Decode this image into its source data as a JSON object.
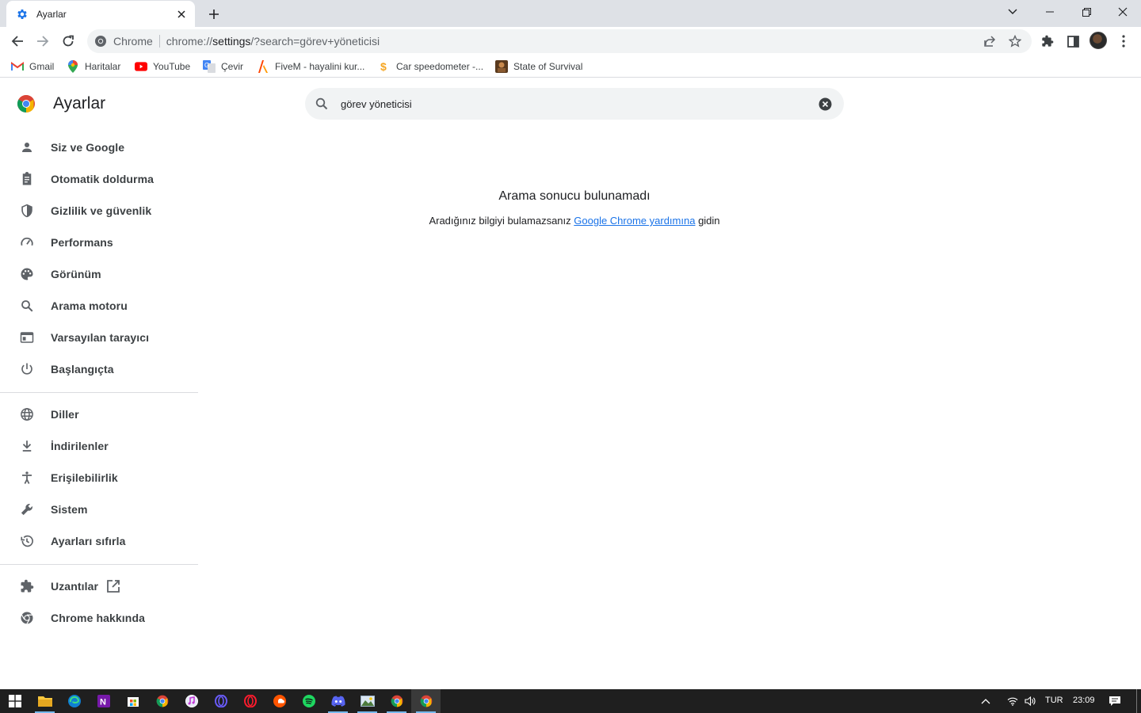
{
  "tab": {
    "title": "Ayarlar"
  },
  "omnibox": {
    "chip": "Chrome",
    "url_host": "chrome://",
    "url_path": "settings",
    "url_query": "/?search=görev+yöneticisi"
  },
  "bookmarks": [
    {
      "label": "Gmail",
      "icon": "gmail-icon"
    },
    {
      "label": "Haritalar",
      "icon": "maps-icon"
    },
    {
      "label": "YouTube",
      "icon": "youtube-icon"
    },
    {
      "label": "Çevir",
      "icon": "translate-icon"
    },
    {
      "label": "FiveM - hayalini kur...",
      "icon": "fivem-icon"
    },
    {
      "label": "Car speedometer -...",
      "icon": "speedometer-icon"
    },
    {
      "label": "State of Survival",
      "icon": "game-icon"
    }
  ],
  "settings": {
    "title": "Ayarlar",
    "search_value": "görev yöneticisi",
    "nav": [
      {
        "label": "Siz ve Google",
        "icon": "person-icon"
      },
      {
        "label": "Otomatik doldurma",
        "icon": "clipboard-icon"
      },
      {
        "label": "Gizlilik ve güvenlik",
        "icon": "shield-icon"
      },
      {
        "label": "Performans",
        "icon": "speedometer-icon"
      },
      {
        "label": "Görünüm",
        "icon": "palette-icon"
      },
      {
        "label": "Arama motoru",
        "icon": "search-icon"
      },
      {
        "label": "Varsayılan tarayıcı",
        "icon": "browser-icon"
      },
      {
        "label": "Başlangıçta",
        "icon": "power-icon"
      },
      {
        "label": "Diller",
        "icon": "globe-icon"
      },
      {
        "label": "İndirilenler",
        "icon": "download-icon"
      },
      {
        "label": "Erişilebilirlik",
        "icon": "accessibility-icon"
      },
      {
        "label": "Sistem",
        "icon": "wrench-icon"
      },
      {
        "label": "Ayarları sıfırla",
        "icon": "history-icon"
      },
      {
        "label": "Uzantılar",
        "icon": "puzzle-icon"
      },
      {
        "label": "Chrome hakkında",
        "icon": "chrome-icon"
      }
    ],
    "no_result_title": "Arama sonucu bulunamadı",
    "help_prefix": "Aradığınız bilgiyi bulamazsanız ",
    "help_link": "Google Chrome yardımına",
    "help_suffix": " gidin"
  },
  "taskbar": {
    "language": "TUR",
    "time": "23:09"
  },
  "colors": {
    "accent": "#1a73e8",
    "tabstrip": "#dee1e6",
    "taskbar": "#1f1f1f"
  }
}
